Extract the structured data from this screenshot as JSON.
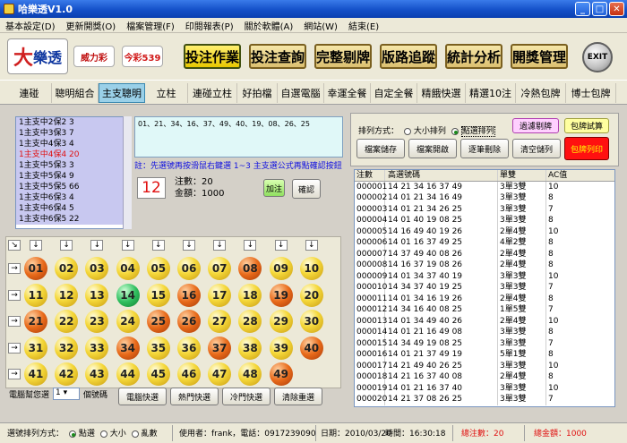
{
  "window": {
    "title": "哈樂透V1.0",
    "min": "_",
    "max": "□",
    "close": "✕"
  },
  "menu": [
    "基本設定(D)",
    "更新開獎(O)",
    "檔案管理(F)",
    "印閱報表(P)",
    "關於軟體(A)",
    "網站(W)",
    "結束(E)"
  ],
  "logos": {
    "lotto_a": "大",
    "lotto_b": "樂透",
    "lotto_sub": "6/49",
    "lotto2": "威力彩",
    "lotto3": "今彩539"
  },
  "topbuttons": [
    "投注作業",
    "投注查詢",
    "完整剔牌",
    "版路追蹤",
    "統計分析",
    "開獎管理"
  ],
  "exit": "EXIT",
  "tabs": [
    "連碰",
    "聰明組合",
    "主支聰明",
    "立柱",
    "連碰立柱",
    "好拍檔",
    "自選電腦",
    "幸運全餐",
    "自定全餐",
    "精餓快選",
    "精選10注",
    "冷熱包牌",
    "博士包牌"
  ],
  "listitems": [
    "1主支中2保2 3",
    "1主支中3保3 7",
    "1主支中4保3 4",
    "1主支中4保4 20",
    "1主支中5保3 3",
    "1主支中5保4 9",
    "1主支中5保5 66",
    "1主支中6保3 4",
    "1主支中6保4 5",
    "1主支中6保5 22"
  ],
  "numbers_text": "01、21、34、16、37、49、40、19、08、26、25",
  "note": "註：先選號再按滑鼠右鍵選 1~3 主支選公式再點確認按鈕",
  "count_big": "12",
  "bets_label": "注數：20",
  "amount_label": "金額：1000",
  "add_btn": "加注",
  "confirm_btn": "確認",
  "arrows_top": "↓",
  "arrows_side": "→",
  "arrow_corner": "↘",
  "balls": [
    [
      "01",
      "o"
    ],
    [
      "02",
      "y"
    ],
    [
      "03",
      "y"
    ],
    [
      "04",
      "y"
    ],
    [
      "05",
      "y"
    ],
    [
      "06",
      "y"
    ],
    [
      "07",
      "y"
    ],
    [
      "08",
      "o"
    ],
    [
      "09",
      "y"
    ],
    [
      "10",
      "y"
    ],
    [
      "11",
      "y"
    ],
    [
      "12",
      "y"
    ],
    [
      "13",
      "y"
    ],
    [
      "14",
      "g"
    ],
    [
      "15",
      "y"
    ],
    [
      "16",
      "o"
    ],
    [
      "17",
      "y"
    ],
    [
      "18",
      "y"
    ],
    [
      "19",
      "o"
    ],
    [
      "20",
      "y"
    ],
    [
      "21",
      "o"
    ],
    [
      "22",
      "y"
    ],
    [
      "23",
      "y"
    ],
    [
      "24",
      "y"
    ],
    [
      "25",
      "o"
    ],
    [
      "26",
      "o"
    ],
    [
      "27",
      "y"
    ],
    [
      "28",
      "y"
    ],
    [
      "29",
      "y"
    ],
    [
      "30",
      "y"
    ],
    [
      "31",
      "y"
    ],
    [
      "32",
      "y"
    ],
    [
      "33",
      "y"
    ],
    [
      "34",
      "o"
    ],
    [
      "35",
      "y"
    ],
    [
      "36",
      "y"
    ],
    [
      "37",
      "o"
    ],
    [
      "38",
      "y"
    ],
    [
      "39",
      "y"
    ],
    [
      "40",
      "o"
    ],
    [
      "41",
      "y"
    ],
    [
      "42",
      "y"
    ],
    [
      "43",
      "y"
    ],
    [
      "44",
      "y"
    ],
    [
      "45",
      "y"
    ],
    [
      "46",
      "y"
    ],
    [
      "47",
      "y"
    ],
    [
      "48",
      "y"
    ],
    [
      "49",
      "o"
    ]
  ],
  "pc_label": "電腦幫您選",
  "pc_value": "1",
  "pc_unit": "個號碼",
  "pc_buttons": [
    "電腦快選",
    "熱門快選",
    "冷門快選",
    "清除重選"
  ],
  "sort": {
    "label": "排列方式：",
    "opt1": "大小排列",
    "opt2": "點選排列",
    "selected": "opt2"
  },
  "right_buttons": {
    "filter": "過濾剔牌",
    "test": "包牌試算",
    "save": "檔案儲存",
    "open": "檔案開啟",
    "delete": "逐筆刪除",
    "clear": "清空儲列",
    "print": "包牌列印"
  },
  "table": {
    "headers": [
      "注數",
      "高選號碼",
      "單雙",
      "AC值"
    ],
    "rows": [
      [
        "000001",
        "14 21 34 16 37 49",
        "3單3雙",
        "10"
      ],
      [
        "000002",
        "14 01 21 34 16 49",
        "3單3雙",
        "8"
      ],
      [
        "000003",
        "14 01 21 34 26 25",
        "3單3雙",
        "7"
      ],
      [
        "000004",
        "14 01 40 19 08 25",
        "3單3雙",
        "8"
      ],
      [
        "000005",
        "14 16 49 40 19 26",
        "2單4雙",
        "10"
      ],
      [
        "000006",
        "14 01 16 37 49 25",
        "4單2雙",
        "8"
      ],
      [
        "000007",
        "14 37 49 40 08 26",
        "2單4雙",
        "8"
      ],
      [
        "000008",
        "14 16 37 19 08 26",
        "2單4雙",
        "8"
      ],
      [
        "000009",
        "14 01 34 37 40 19",
        "3單3雙",
        "10"
      ],
      [
        "000010",
        "14 34 37 40 19 25",
        "3單3雙",
        "7"
      ],
      [
        "000011",
        "14 01 34 16 19 26",
        "2單4雙",
        "8"
      ],
      [
        "000012",
        "14 34 16 40 08 25",
        "1單5雙",
        "7"
      ],
      [
        "000013",
        "14 01 34 49 40 26",
        "2單4雙",
        "10"
      ],
      [
        "000014",
        "14 01 21 16 49 08",
        "3單3雙",
        "8"
      ],
      [
        "000015",
        "14 34 49 19 08 25",
        "3單3雙",
        "7"
      ],
      [
        "000016",
        "14 01 21 37 49 19",
        "5單1雙",
        "8"
      ],
      [
        "000017",
        "14 21 49 40 26 25",
        "3單3雙",
        "10"
      ],
      [
        "000018",
        "14 21 16 37 40 08",
        "2單4雙",
        "8"
      ],
      [
        "000019",
        "14 01 21 16 37 40",
        "3單3雙",
        "10"
      ],
      [
        "000020",
        "14 21 37 08 26 25",
        "3單3雙",
        "7"
      ]
    ]
  },
  "status": {
    "sel_label": "選號排列方式：",
    "opt_click": "點選",
    "opt_size": "大小",
    "opt_random": "亂數",
    "user": "使用者：frank，電話：0917239090",
    "date": "日期：2010/03/20",
    "time": "時間：16:30:18",
    "total_bets": "總注數：20",
    "total_amount": "總金額：1000"
  }
}
